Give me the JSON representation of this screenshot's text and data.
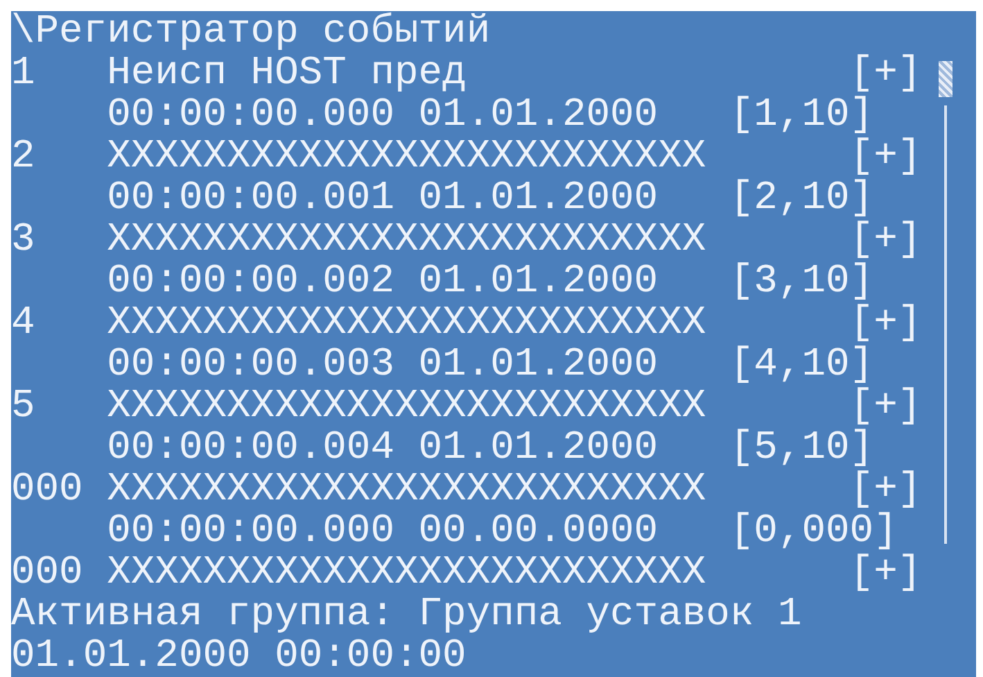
{
  "title": "\\Регистратор событий",
  "events": [
    {
      "number": "1",
      "name": "Неисп HOST пред",
      "expand": "[+]",
      "time_date": "00:00:00.000 01.01.2000",
      "code": "[1,10]"
    },
    {
      "number": "2",
      "name": "XXXXXXXXXXXXXXXXXXXXXXXXX",
      "expand": "[+]",
      "time_date": "00:00:00.001 01.01.2000",
      "code": "[2,10]"
    },
    {
      "number": "3",
      "name": "XXXXXXXXXXXXXXXXXXXXXXXXX",
      "expand": "[+]",
      "time_date": "00:00:00.002 01.01.2000",
      "code": "[3,10]"
    },
    {
      "number": "4",
      "name": "XXXXXXXXXXXXXXXXXXXXXXXXX",
      "expand": "[+]",
      "time_date": "00:00:00.003 01.01.2000",
      "code": "[4,10]"
    },
    {
      "number": "5",
      "name": "XXXXXXXXXXXXXXXXXXXXXXXXX",
      "expand": "[+]",
      "time_date": "00:00:00.004 01.01.2000",
      "code": "[5,10]"
    },
    {
      "number": "000",
      "name": "XXXXXXXXXXXXXXXXXXXXXXXXX",
      "expand": "[+]",
      "time_date": "00:00:00.000 00.00.0000",
      "code": "[0,000]"
    },
    {
      "number": "000",
      "name": "XXXXXXXXXXXXXXXXXXXXXXXXX",
      "expand": "[+]"
    }
  ],
  "status": {
    "active_group": "Активная группа: Группа уставок 1",
    "datetime": "01.01.2000 00:00:00"
  }
}
